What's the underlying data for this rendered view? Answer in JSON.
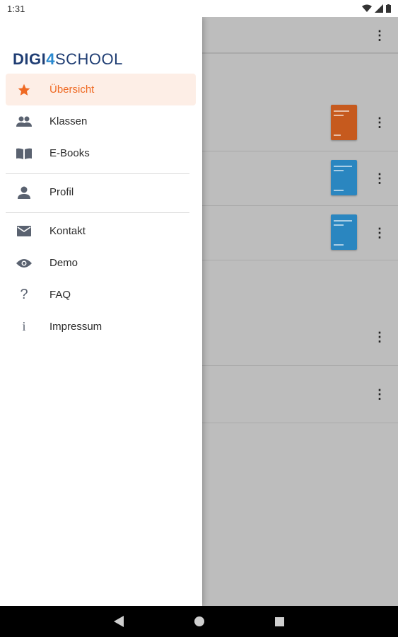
{
  "status_bar": {
    "time": "1:31"
  },
  "logo": {
    "part1": "DIGI",
    "four": "4",
    "part2": "SCHOOL"
  },
  "drawer": {
    "items": [
      {
        "label": "Übersicht",
        "icon": "star-icon",
        "active": true
      },
      {
        "label": "Klassen",
        "icon": "people-icon"
      },
      {
        "label": "E-Books",
        "icon": "book-icon"
      },
      {
        "label": "Profil",
        "icon": "person-icon"
      },
      {
        "label": "Kontakt",
        "icon": "mail-icon"
      },
      {
        "label": "Demo",
        "icon": "eye-icon"
      },
      {
        "label": "FAQ",
        "icon": "question-icon"
      },
      {
        "label": "Impressum",
        "icon": "info-icon"
      }
    ]
  },
  "colors": {
    "accent": "#ef6a24",
    "active_bg": "#fdeee6",
    "brand_dark": "#1f3d73",
    "brand_light": "#2a8ad1"
  }
}
